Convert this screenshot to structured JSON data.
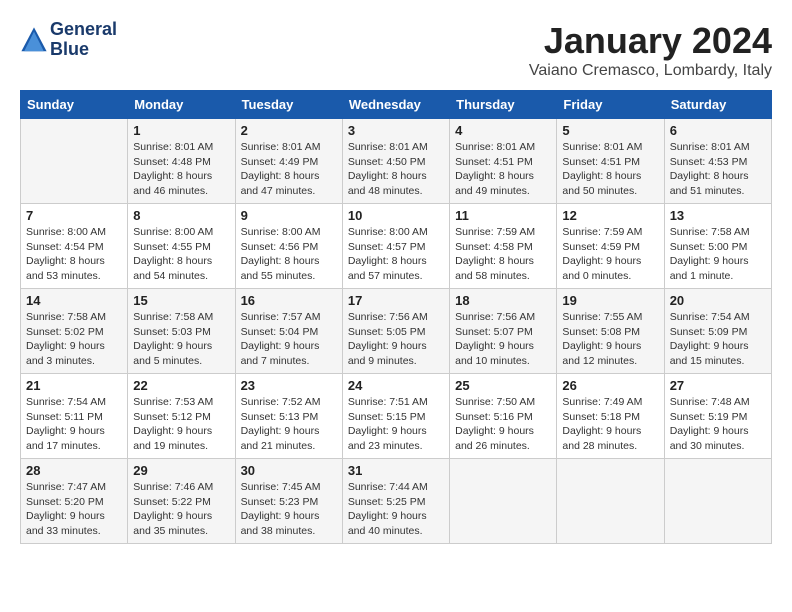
{
  "header": {
    "logo_line1": "General",
    "logo_line2": "Blue",
    "month_title": "January 2024",
    "location": "Vaiano Cremasco, Lombardy, Italy"
  },
  "weekdays": [
    "Sunday",
    "Monday",
    "Tuesday",
    "Wednesday",
    "Thursday",
    "Friday",
    "Saturday"
  ],
  "weeks": [
    [
      {
        "day": "",
        "info": ""
      },
      {
        "day": "1",
        "info": "Sunrise: 8:01 AM\nSunset: 4:48 PM\nDaylight: 8 hours\nand 46 minutes."
      },
      {
        "day": "2",
        "info": "Sunrise: 8:01 AM\nSunset: 4:49 PM\nDaylight: 8 hours\nand 47 minutes."
      },
      {
        "day": "3",
        "info": "Sunrise: 8:01 AM\nSunset: 4:50 PM\nDaylight: 8 hours\nand 48 minutes."
      },
      {
        "day": "4",
        "info": "Sunrise: 8:01 AM\nSunset: 4:51 PM\nDaylight: 8 hours\nand 49 minutes."
      },
      {
        "day": "5",
        "info": "Sunrise: 8:01 AM\nSunset: 4:51 PM\nDaylight: 8 hours\nand 50 minutes."
      },
      {
        "day": "6",
        "info": "Sunrise: 8:01 AM\nSunset: 4:53 PM\nDaylight: 8 hours\nand 51 minutes."
      }
    ],
    [
      {
        "day": "7",
        "info": "Sunrise: 8:00 AM\nSunset: 4:54 PM\nDaylight: 8 hours\nand 53 minutes."
      },
      {
        "day": "8",
        "info": "Sunrise: 8:00 AM\nSunset: 4:55 PM\nDaylight: 8 hours\nand 54 minutes."
      },
      {
        "day": "9",
        "info": "Sunrise: 8:00 AM\nSunset: 4:56 PM\nDaylight: 8 hours\nand 55 minutes."
      },
      {
        "day": "10",
        "info": "Sunrise: 8:00 AM\nSunset: 4:57 PM\nDaylight: 8 hours\nand 57 minutes."
      },
      {
        "day": "11",
        "info": "Sunrise: 7:59 AM\nSunset: 4:58 PM\nDaylight: 8 hours\nand 58 minutes."
      },
      {
        "day": "12",
        "info": "Sunrise: 7:59 AM\nSunset: 4:59 PM\nDaylight: 9 hours\nand 0 minutes."
      },
      {
        "day": "13",
        "info": "Sunrise: 7:58 AM\nSunset: 5:00 PM\nDaylight: 9 hours\nand 1 minute."
      }
    ],
    [
      {
        "day": "14",
        "info": "Sunrise: 7:58 AM\nSunset: 5:02 PM\nDaylight: 9 hours\nand 3 minutes."
      },
      {
        "day": "15",
        "info": "Sunrise: 7:58 AM\nSunset: 5:03 PM\nDaylight: 9 hours\nand 5 minutes."
      },
      {
        "day": "16",
        "info": "Sunrise: 7:57 AM\nSunset: 5:04 PM\nDaylight: 9 hours\nand 7 minutes."
      },
      {
        "day": "17",
        "info": "Sunrise: 7:56 AM\nSunset: 5:05 PM\nDaylight: 9 hours\nand 9 minutes."
      },
      {
        "day": "18",
        "info": "Sunrise: 7:56 AM\nSunset: 5:07 PM\nDaylight: 9 hours\nand 10 minutes."
      },
      {
        "day": "19",
        "info": "Sunrise: 7:55 AM\nSunset: 5:08 PM\nDaylight: 9 hours\nand 12 minutes."
      },
      {
        "day": "20",
        "info": "Sunrise: 7:54 AM\nSunset: 5:09 PM\nDaylight: 9 hours\nand 15 minutes."
      }
    ],
    [
      {
        "day": "21",
        "info": "Sunrise: 7:54 AM\nSunset: 5:11 PM\nDaylight: 9 hours\nand 17 minutes."
      },
      {
        "day": "22",
        "info": "Sunrise: 7:53 AM\nSunset: 5:12 PM\nDaylight: 9 hours\nand 19 minutes."
      },
      {
        "day": "23",
        "info": "Sunrise: 7:52 AM\nSunset: 5:13 PM\nDaylight: 9 hours\nand 21 minutes."
      },
      {
        "day": "24",
        "info": "Sunrise: 7:51 AM\nSunset: 5:15 PM\nDaylight: 9 hours\nand 23 minutes."
      },
      {
        "day": "25",
        "info": "Sunrise: 7:50 AM\nSunset: 5:16 PM\nDaylight: 9 hours\nand 26 minutes."
      },
      {
        "day": "26",
        "info": "Sunrise: 7:49 AM\nSunset: 5:18 PM\nDaylight: 9 hours\nand 28 minutes."
      },
      {
        "day": "27",
        "info": "Sunrise: 7:48 AM\nSunset: 5:19 PM\nDaylight: 9 hours\nand 30 minutes."
      }
    ],
    [
      {
        "day": "28",
        "info": "Sunrise: 7:47 AM\nSunset: 5:20 PM\nDaylight: 9 hours\nand 33 minutes."
      },
      {
        "day": "29",
        "info": "Sunrise: 7:46 AM\nSunset: 5:22 PM\nDaylight: 9 hours\nand 35 minutes."
      },
      {
        "day": "30",
        "info": "Sunrise: 7:45 AM\nSunset: 5:23 PM\nDaylight: 9 hours\nand 38 minutes."
      },
      {
        "day": "31",
        "info": "Sunrise: 7:44 AM\nSunset: 5:25 PM\nDaylight: 9 hours\nand 40 minutes."
      },
      {
        "day": "",
        "info": ""
      },
      {
        "day": "",
        "info": ""
      },
      {
        "day": "",
        "info": ""
      }
    ]
  ]
}
